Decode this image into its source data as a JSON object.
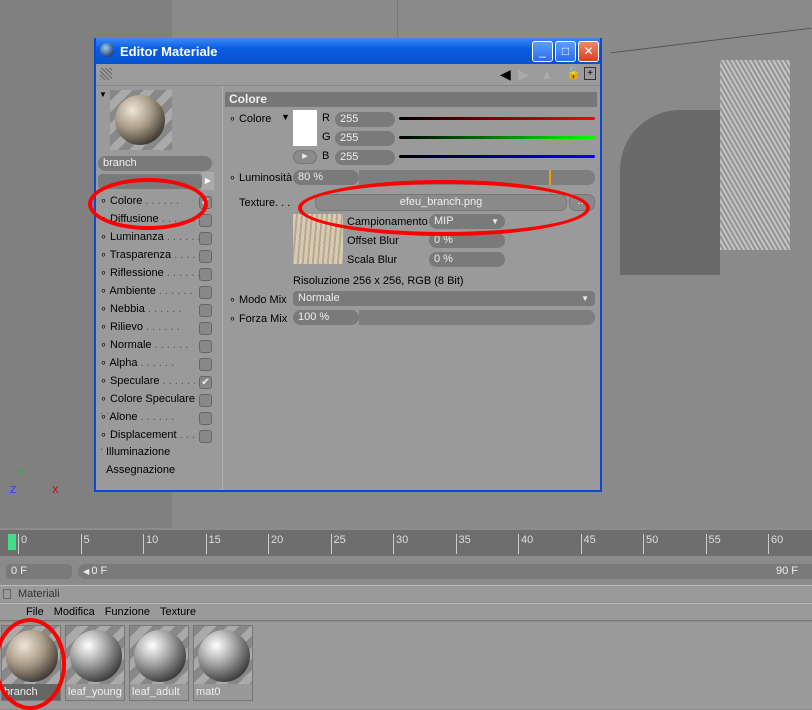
{
  "window": {
    "title": "Editor Materiale",
    "min": "_",
    "max": "□",
    "close": "✕"
  },
  "material": {
    "name": "branch"
  },
  "channels": [
    {
      "label": "Colore",
      "checked": true,
      "dot": true
    },
    {
      "label": "Diffusione",
      "checked": false,
      "dot": true
    },
    {
      "label": "Luminanza",
      "checked": false,
      "dot": true
    },
    {
      "label": "Trasparenza",
      "checked": false,
      "dot": true
    },
    {
      "label": "Riflessione",
      "checked": false,
      "dot": true
    },
    {
      "label": "Ambiente",
      "checked": false,
      "dot": true
    },
    {
      "label": "Nebbia",
      "checked": false,
      "dot": true
    },
    {
      "label": "Rilievo",
      "checked": false,
      "dot": true
    },
    {
      "label": "Normale",
      "checked": false,
      "dot": true
    },
    {
      "label": "Alpha",
      "checked": false,
      "dot": true
    },
    {
      "label": "Speculare",
      "checked": true,
      "dot": true
    },
    {
      "label": "Colore Speculare",
      "checked": false,
      "dot": true
    },
    {
      "label": "Alone",
      "checked": false,
      "dot": true
    },
    {
      "label": "Displacement",
      "checked": false,
      "dot": true
    },
    {
      "label": "Illuminazione",
      "checked": null,
      "dot": false
    },
    {
      "label": "Assegnazione",
      "checked": null,
      "dot": false
    }
  ],
  "panel": {
    "section": "Colore",
    "color_label": "Colore",
    "r_label": "R",
    "r": "255",
    "g_label": "G",
    "g": "255",
    "b_label": "B",
    "b": "255",
    "lum_label": "Luminosità",
    "lum": "80 %",
    "texture_label": "Texture. . .",
    "texture_file": "efeu_branch.png",
    "texture_more": "...",
    "sampling_label": "Campionamento",
    "sampling": "MIP",
    "offset_label": "Offset Blur",
    "offset": "0 %",
    "scale_label": "Scala Blur",
    "scale": "0 %",
    "resolution": "Risoluzione 256 x 256, RGB (8 Bit)",
    "mix_mode_label": "Modo Mix",
    "mix_mode": "Normale",
    "mix_strength_label": "Forza Mix",
    "mix_strength": "100 %"
  },
  "timeline": {
    "ticks": [
      "0",
      "5",
      "10",
      "15",
      "20",
      "25",
      "30",
      "35",
      "40",
      "45",
      "50",
      "55",
      "60"
    ],
    "current": "0 F",
    "start": "0 F",
    "end": "90 F"
  },
  "materials_panel": {
    "title": "Materiali",
    "menu": [
      "File",
      "Modifica",
      "Funzione",
      "Texture"
    ],
    "items": [
      {
        "name": "branch",
        "textured": true
      },
      {
        "name": "leaf_young"
      },
      {
        "name": "leaf_adult"
      },
      {
        "name": "mat0"
      }
    ]
  },
  "colors": {
    "accent_highlight": "#ff0000",
    "title_bar": "#0a5ee0"
  }
}
